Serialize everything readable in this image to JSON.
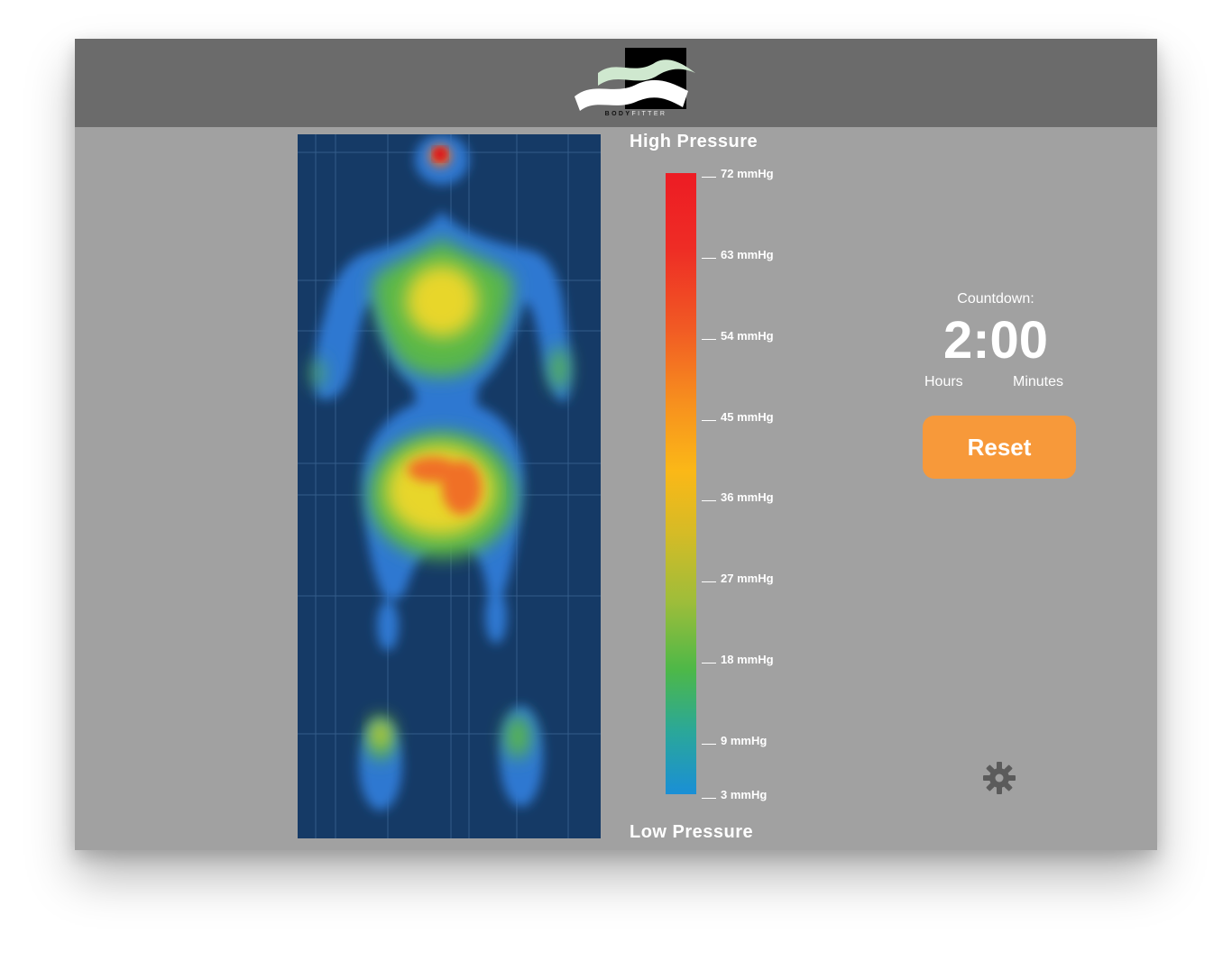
{
  "header": {
    "logo_wordmark_bold": "BODY",
    "logo_wordmark_light": "FITTER"
  },
  "scale": {
    "high_label": "High Pressure",
    "low_label": "Low Pressure",
    "unit": "mmHg",
    "ticks": [
      {
        "value": 72,
        "label": "72 mmHg"
      },
      {
        "value": 63,
        "label": "63 mmHg"
      },
      {
        "value": 54,
        "label": "54 mmHg"
      },
      {
        "value": 45,
        "label": "45 mmHg"
      },
      {
        "value": 36,
        "label": "36 mmHg"
      },
      {
        "value": 27,
        "label": "27 mmHg"
      },
      {
        "value": 18,
        "label": "18 mmHg"
      },
      {
        "value": 9,
        "label": "9 mmHg"
      },
      {
        "value": 3,
        "label": "3 mmHg"
      }
    ],
    "colors": {
      "high": "#ed1c24",
      "mid_high": "#f7901e",
      "mid": "#fbb817",
      "mid_low": "#4db848",
      "low": "#1a8fd6"
    }
  },
  "countdown": {
    "label": "Countdown:",
    "value": "2:00",
    "hours_label": "Hours",
    "minutes_label": "Minutes"
  },
  "actions": {
    "reset_label": "Reset",
    "settings_icon": "gear-icon"
  },
  "theme": {
    "header_bg": "#6b6b6b",
    "body_bg": "#a1a1a1",
    "map_bg": "#153a66",
    "accent": "#f7993a"
  }
}
